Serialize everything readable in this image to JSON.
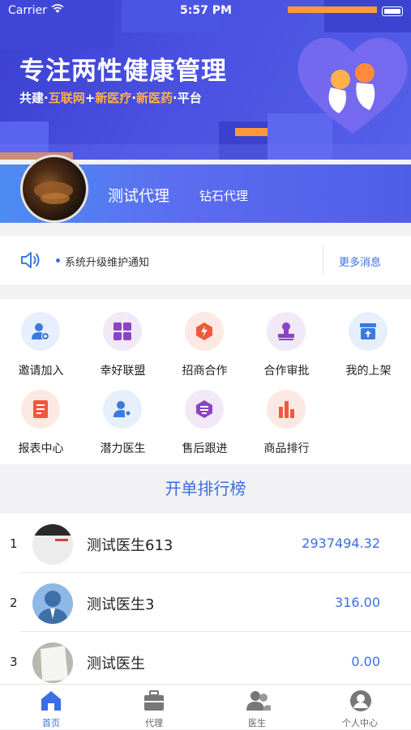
{
  "status_bar": {
    "carrier": "Carrier",
    "time": "5:57 PM"
  },
  "banner": {
    "title": "专注两性健康管理",
    "subtitle_parts": [
      "共建·",
      "互联网",
      "+",
      "新医疗",
      "·",
      "新医药",
      "·平台"
    ]
  },
  "profile": {
    "name": "测试代理",
    "level": "钻石代理"
  },
  "notice": {
    "text": "系统升级维护通知",
    "more": "更多消息"
  },
  "menu": [
    {
      "label": "邀请加入",
      "icon": "invite-user-icon",
      "bg": "#e6f0fc",
      "fg": "#3b7be0"
    },
    {
      "label": "幸好联盟",
      "icon": "grid-icon",
      "bg": "#f1e8f8",
      "fg": "#8a44c4"
    },
    {
      "label": "招商合作",
      "icon": "lightning-icon",
      "bg": "#fde9e4",
      "fg": "#f0583a"
    },
    {
      "label": "合作审批",
      "icon": "stamp-icon",
      "bg": "#f1e8f8",
      "fg": "#8a44c4"
    },
    {
      "label": "我的上架",
      "icon": "shelf-upload-icon",
      "bg": "#e6f0fc",
      "fg": "#3b7be0"
    },
    {
      "label": "报表中心",
      "icon": "report-icon",
      "bg": "#fde9e4",
      "fg": "#f0583a"
    },
    {
      "label": "潜力医生",
      "icon": "doctor-icon",
      "bg": "#e6f0fc",
      "fg": "#3b7be0"
    },
    {
      "label": "售后跟进",
      "icon": "after-sale-icon",
      "bg": "#f1e8f8",
      "fg": "#8a44c4"
    },
    {
      "label": "商品排行",
      "icon": "bar-chart-icon",
      "bg": "#fde9e4",
      "fg": "#f0583a"
    }
  ],
  "ranking": {
    "title": "开单排行榜",
    "rows": [
      {
        "rank": "1",
        "name": "测试医生613",
        "amount": "2937494.32"
      },
      {
        "rank": "2",
        "name": "测试医生3",
        "amount": "316.00"
      },
      {
        "rank": "3",
        "name": "测试医生",
        "amount": "0.00"
      }
    ]
  },
  "tabs": [
    {
      "label": "首页",
      "icon": "home-icon",
      "active": true
    },
    {
      "label": "代理",
      "icon": "briefcase-icon",
      "active": false
    },
    {
      "label": "医生",
      "icon": "doctors-icon",
      "active": false
    },
    {
      "label": "个人中心",
      "icon": "person-icon",
      "active": false
    }
  ],
  "colors": {
    "accent": "#3b6ee3",
    "banner": "#4a50e0",
    "highlight": "#ffb14a"
  }
}
